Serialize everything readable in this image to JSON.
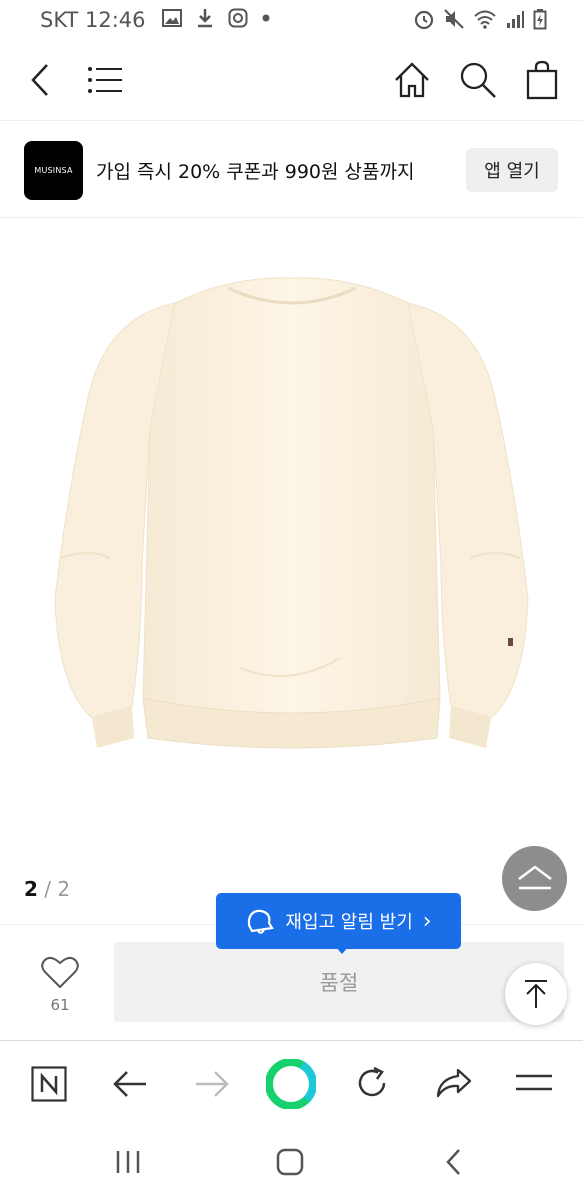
{
  "status_bar": {
    "carrier": "SKT",
    "time": "12:46"
  },
  "banner": {
    "logo_text": "MUSINSA",
    "promo_text": "가입 즉시 20% 쿠폰과 990원 상품까지",
    "open_app_label": "앱 열기"
  },
  "gallery": {
    "current": "2",
    "separator": "/",
    "total": "2"
  },
  "restock": {
    "label": "재입고 알림 받기",
    "chevron": "›"
  },
  "purchase": {
    "like_count": "61",
    "soldout_label": "품절"
  },
  "colors": {
    "accent_blue": "#1a6fe8",
    "sweatshirt": "#fcf3e3"
  },
  "icons": [
    "back-icon",
    "menu-icon",
    "home-icon",
    "search-icon",
    "cart-icon",
    "heart-icon",
    "bell-icon",
    "chevron-up-icon",
    "scroll-top-icon",
    "naver-icon",
    "browser-back-icon",
    "browser-forward-icon",
    "green-dot-icon",
    "reload-icon",
    "share-icon",
    "browser-menu-icon",
    "recent-apps-icon",
    "system-home-icon",
    "system-back-icon"
  ]
}
